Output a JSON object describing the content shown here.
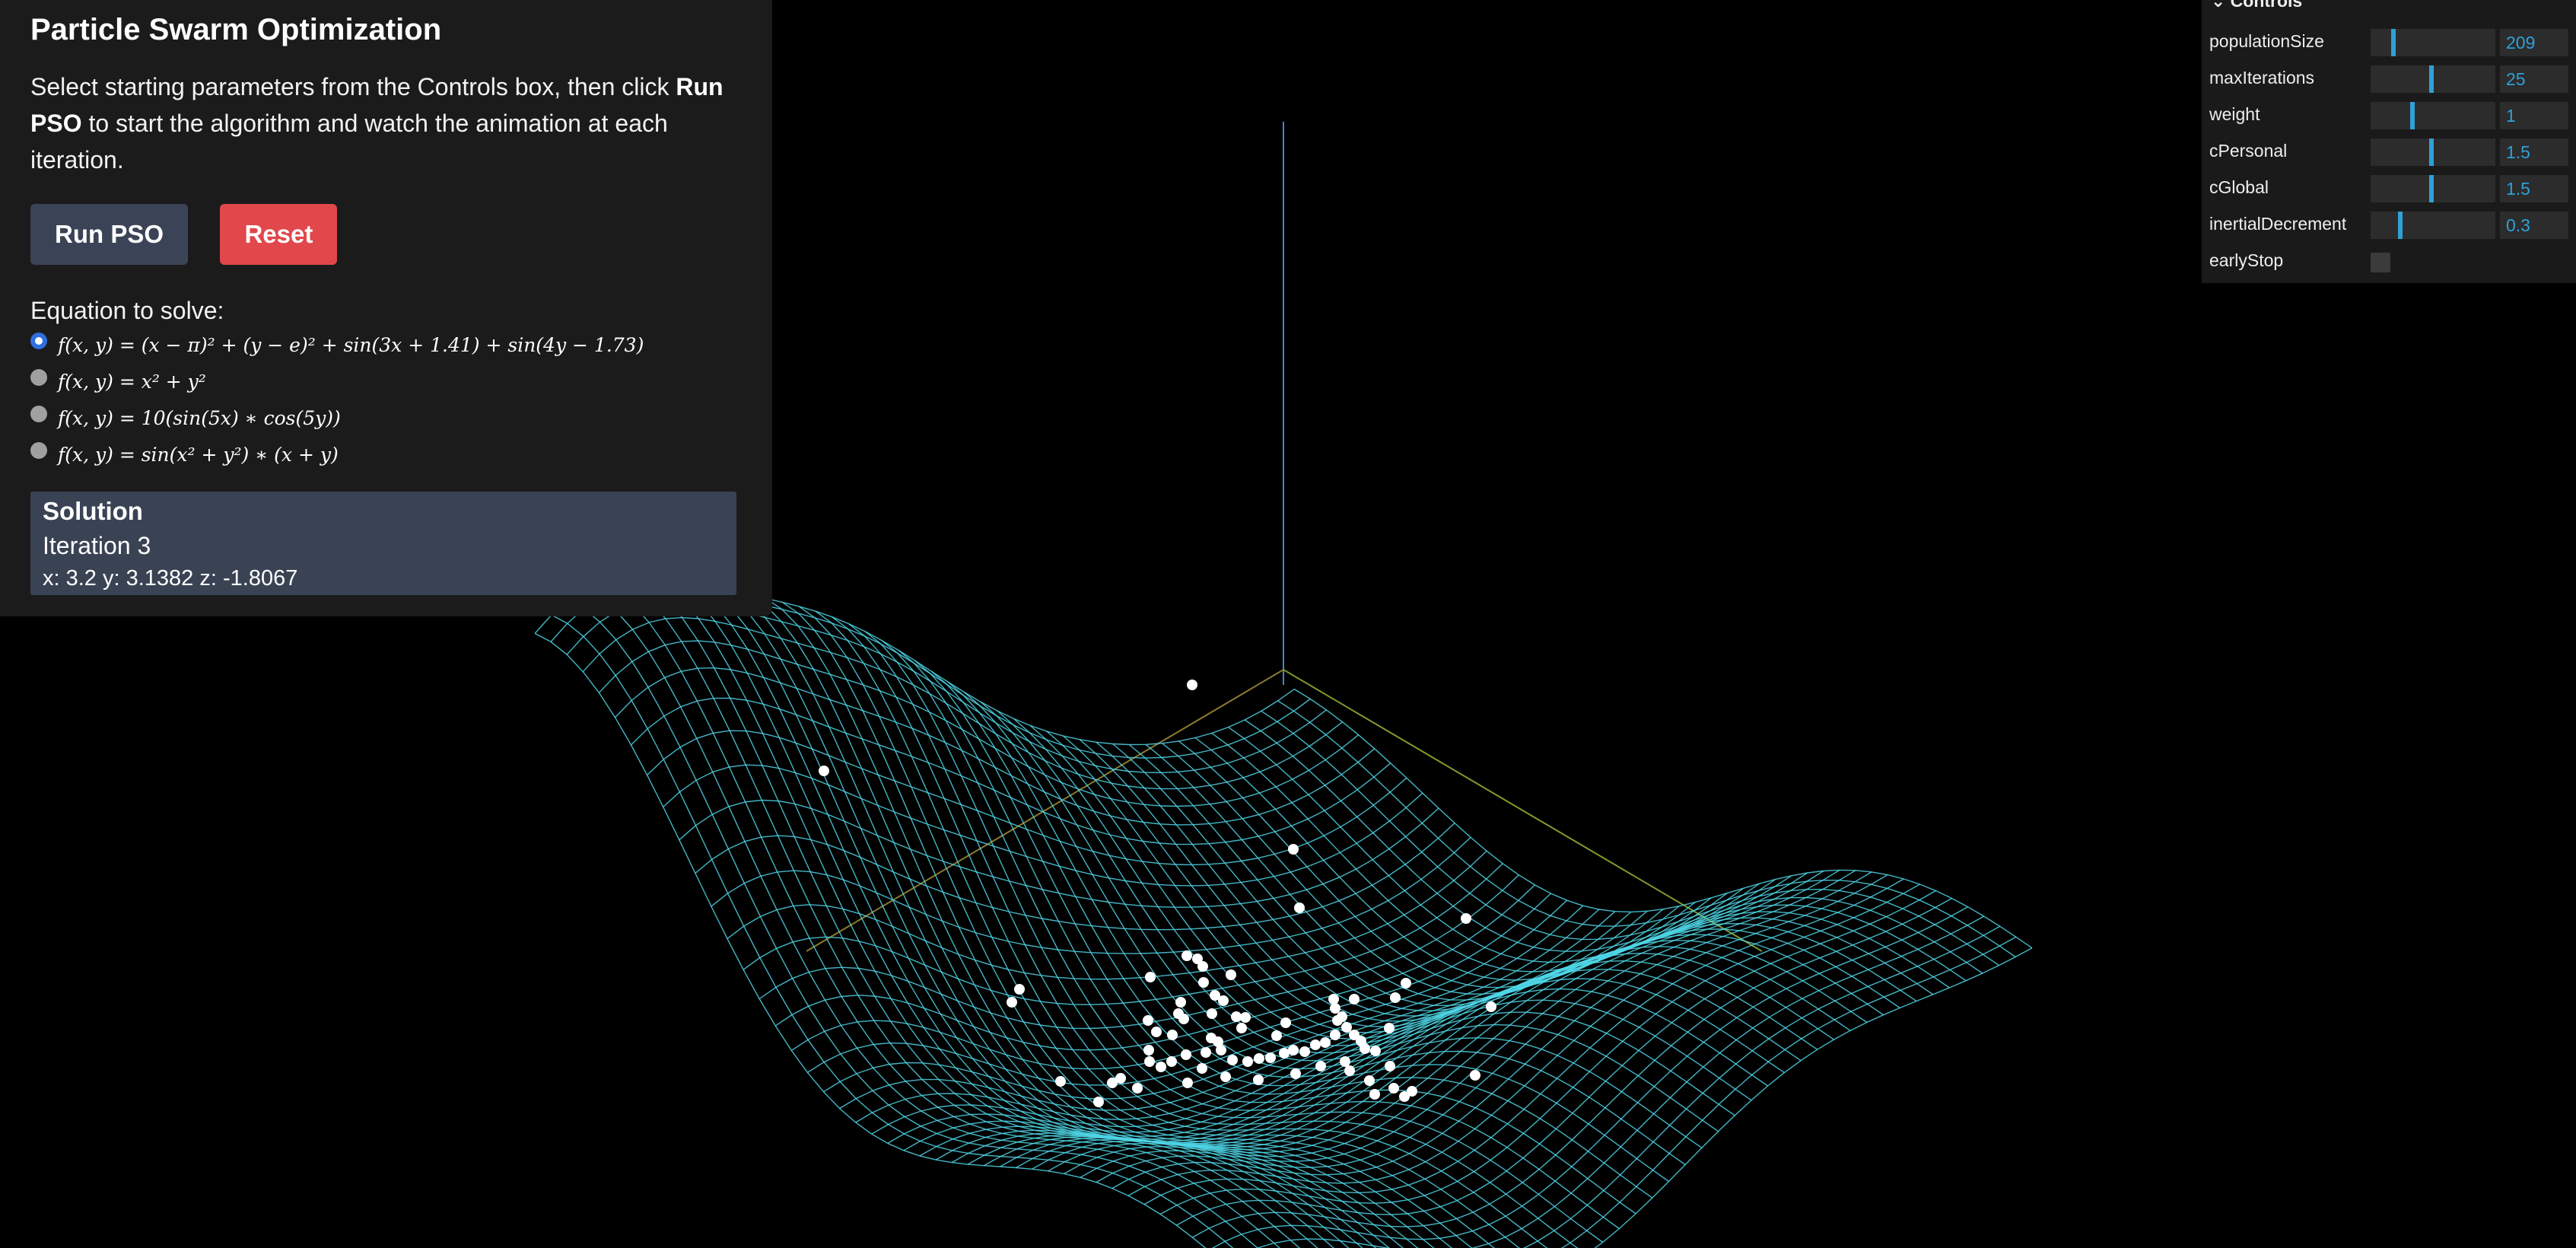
{
  "info": {
    "title": "Particle Swarm Optimization",
    "intro_before": "Select starting parameters from the Controls box, then click ",
    "intro_bold": "Run PSO",
    "intro_after": " to start the algorithm and watch the animation at each iteration.",
    "run_button": "Run PSO",
    "reset_button": "Reset",
    "equation_heading": "Equation to solve:",
    "equations": [
      {
        "label": "f(x, y) = (x − π)² + (y − e)² + sin(3x + 1.41) + sin(4y − 1.73)",
        "checked": true
      },
      {
        "label": "f(x, y) = x² + y²",
        "checked": false
      },
      {
        "label": "f(x, y) = 10(sin(5x) ∗ cos(5y))",
        "checked": false
      },
      {
        "label": "f(x, y) = sin(x² + y²) ∗ (x + y)",
        "checked": false
      }
    ],
    "solution": {
      "title": "Solution",
      "iteration": "Iteration 3",
      "coords": "x: 3.2 y: 3.1382 z: -1.8067"
    }
  },
  "controls": {
    "header": "Controls",
    "rows": [
      {
        "label": "populationSize",
        "value": "209",
        "fraction": 0.17
      },
      {
        "label": "maxIterations",
        "value": "25",
        "fraction": 0.49
      },
      {
        "label": "weight",
        "value": "1",
        "fraction": 0.33
      },
      {
        "label": "cPersonal",
        "value": "1.5",
        "fraction": 0.49
      },
      {
        "label": "cGlobal",
        "value": "1.5",
        "fraction": 0.49
      },
      {
        "label": "inertialDecrement",
        "value": "0.3",
        "fraction": 0.23
      }
    ],
    "early_stop_label": "earlyStop",
    "early_stop_checked": false
  },
  "colors": {
    "mesh": "#4fd6e6",
    "particles": "#ffffff",
    "axis_x": "#8a7a2e",
    "axis_y": "#3a8ad0",
    "axis_z": "#7f9a2a",
    "slider_accent": "#2fa1d6",
    "run_button": "#3b4456",
    "reset_button": "#e1474b",
    "solution_box": "#3a4354"
  }
}
